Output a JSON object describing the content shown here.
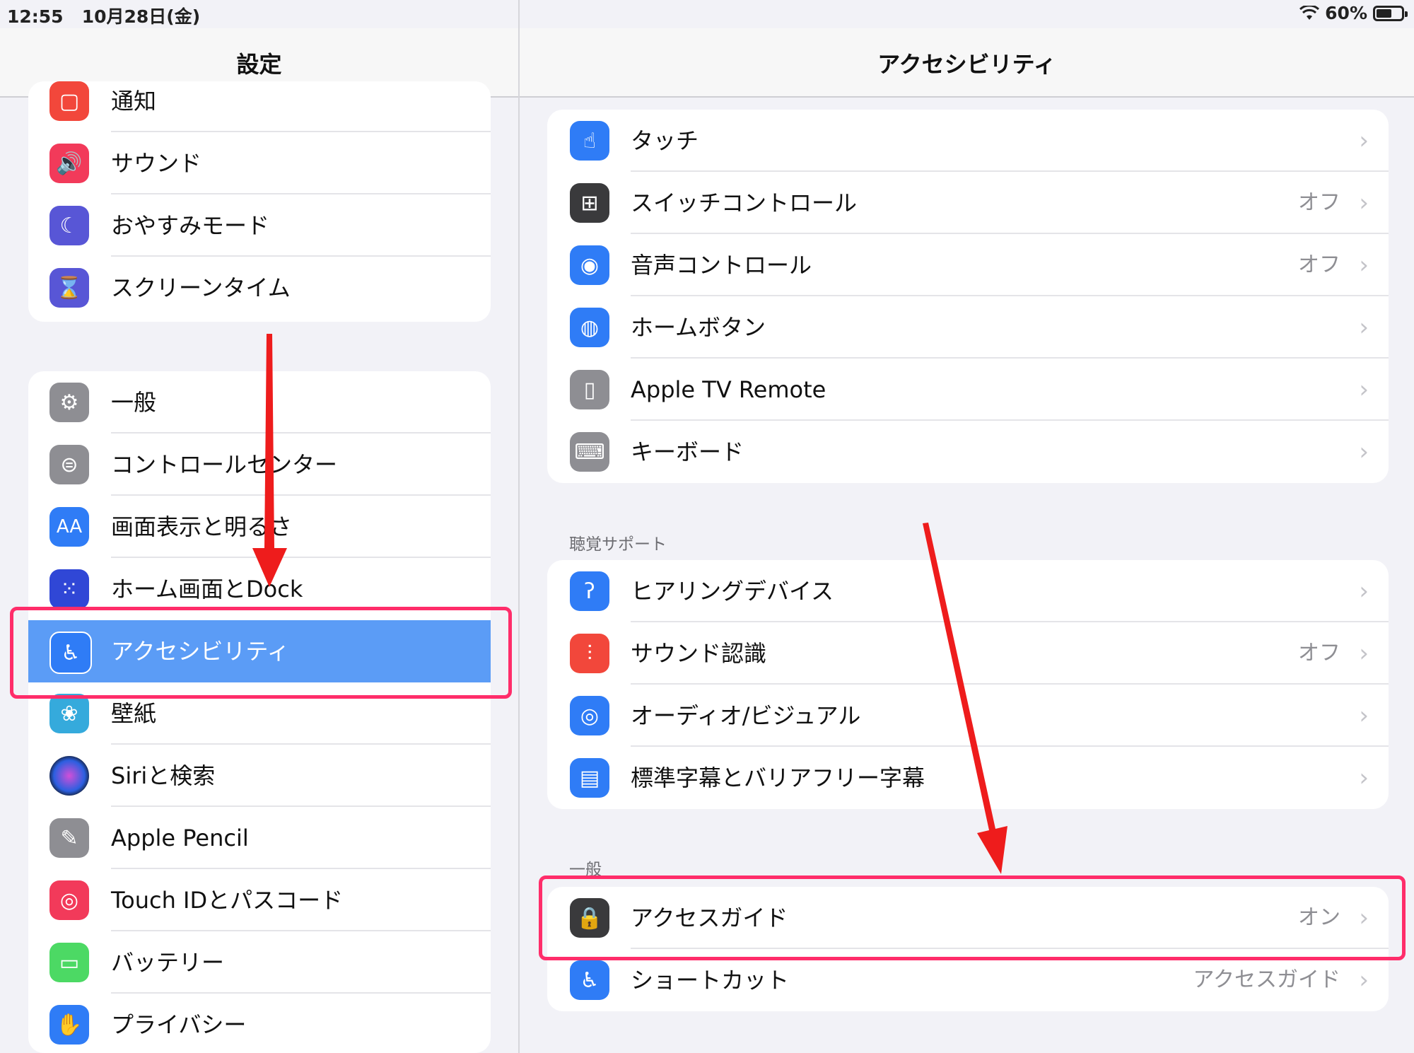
{
  "status_bar": {
    "time": "12:55",
    "date": "10月28日(金)",
    "battery": "60%"
  },
  "left": {
    "title": "設定",
    "group1": [
      {
        "label": "通知",
        "icon": "notifications-icon",
        "color": "#f2473b"
      },
      {
        "label": "サウンド",
        "icon": "sound-icon",
        "color": "#f23a5a"
      },
      {
        "label": "おやすみモード",
        "icon": "moon-icon",
        "color": "#5856d6"
      },
      {
        "label": "スクリーンタイム",
        "icon": "hourglass-icon",
        "color": "#5856d6"
      }
    ],
    "group2": [
      {
        "label": "一般",
        "icon": "gear-icon",
        "color": "#8e8e93"
      },
      {
        "label": "コントロールセンター",
        "icon": "toggles-icon",
        "color": "#8e8e93"
      },
      {
        "label": "画面表示と明るさ",
        "icon": "text-size-icon",
        "color": "#2f7cf6"
      },
      {
        "label": "ホーム画面とDock",
        "icon": "home-grid-icon",
        "color": "#3047d6"
      },
      {
        "label": "アクセシビリティ",
        "icon": "accessibility-icon",
        "color": "#2f7cf6",
        "selected": true
      },
      {
        "label": "壁紙",
        "icon": "flower-icon",
        "color": "#35aadc"
      },
      {
        "label": "Siriと検索",
        "icon": "siri-icon",
        "color": "#222244"
      },
      {
        "label": "Apple Pencil",
        "icon": "pencil-icon",
        "color": "#8e8e93"
      },
      {
        "label": "Touch IDとパスコード",
        "icon": "fingerprint-icon",
        "color": "#f23a5a"
      },
      {
        "label": "バッテリー",
        "icon": "battery-icon",
        "color": "#4cd964"
      },
      {
        "label": "プライバシー",
        "icon": "hand-icon",
        "color": "#2f7cf6"
      }
    ]
  },
  "right": {
    "title": "アクセシビリティ",
    "group1": [
      {
        "label": "タッチ",
        "value": "",
        "icon": "touch-hand-icon",
        "color": "#2f7cf6"
      },
      {
        "label": "スイッチコントロール",
        "value": "オフ",
        "icon": "grid-icon",
        "color": "#3a3a3c"
      },
      {
        "label": "音声コントロール",
        "value": "オフ",
        "icon": "voice-control-icon",
        "color": "#2f7cf6"
      },
      {
        "label": "ホームボタン",
        "value": "",
        "icon": "home-button-icon",
        "color": "#2f7cf6"
      },
      {
        "label": "Apple TV Remote",
        "value": "",
        "icon": "remote-icon",
        "color": "#8e8e93"
      },
      {
        "label": "キーボード",
        "value": "",
        "icon": "keyboard-icon",
        "color": "#8e8e93"
      }
    ],
    "hearing_header": "聴覚サポート",
    "group2": [
      {
        "label": "ヒアリングデバイス",
        "value": "",
        "icon": "ear-icon",
        "color": "#2f7cf6"
      },
      {
        "label": "サウンド認識",
        "value": "オフ",
        "icon": "sound-recognition-icon",
        "color": "#f2473b"
      },
      {
        "label": "オーディオ/ビジュアル",
        "value": "",
        "icon": "audio-visual-icon",
        "color": "#2f7cf6"
      },
      {
        "label": "標準字幕とバリアフリー字幕",
        "value": "",
        "icon": "captions-icon",
        "color": "#2f7cf6"
      }
    ],
    "general_header": "一般",
    "group3": [
      {
        "label": "アクセスガイド",
        "value": "オン",
        "icon": "lock-icon",
        "color": "#3a3a3c"
      },
      {
        "label": "ショートカット",
        "value": "アクセスガイド",
        "icon": "accessibility-shortcut-icon",
        "color": "#2f7cf6"
      }
    ]
  },
  "colors": {
    "highlight": "#ff2d6a",
    "arrow": "#ee1c1c",
    "selected": "#5b9cf6"
  }
}
